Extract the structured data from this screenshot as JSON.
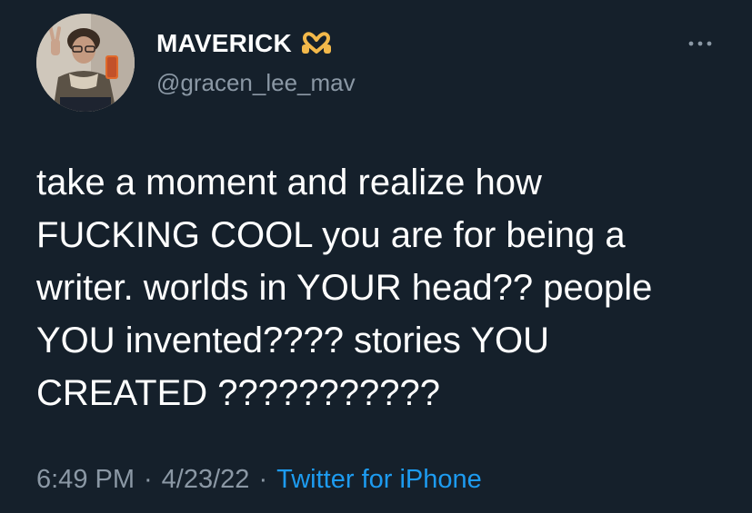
{
  "user": {
    "display_name": "MAVERICK",
    "handle": "@gracen_lee_mav",
    "name_emoji": "heart-hands-emoji"
  },
  "tweet": {
    "lines": [
      "take a moment and realize how",
      "FUCKING COOL you are for being a",
      "writer. worlds in YOUR head?? people",
      "YOU invented???? stories YOU",
      "CREATED ???????????"
    ]
  },
  "meta": {
    "time": "6:49 PM",
    "separator": "·",
    "date": "4/23/22",
    "source": "Twitter for iPhone"
  },
  "colors": {
    "background": "#15202b",
    "primary_text": "#ffffff",
    "secondary_text": "#8b98a5",
    "link": "#1d9bf0"
  },
  "icons": {
    "more": "more-horizontal-icon",
    "avatar": "profile-avatar"
  }
}
